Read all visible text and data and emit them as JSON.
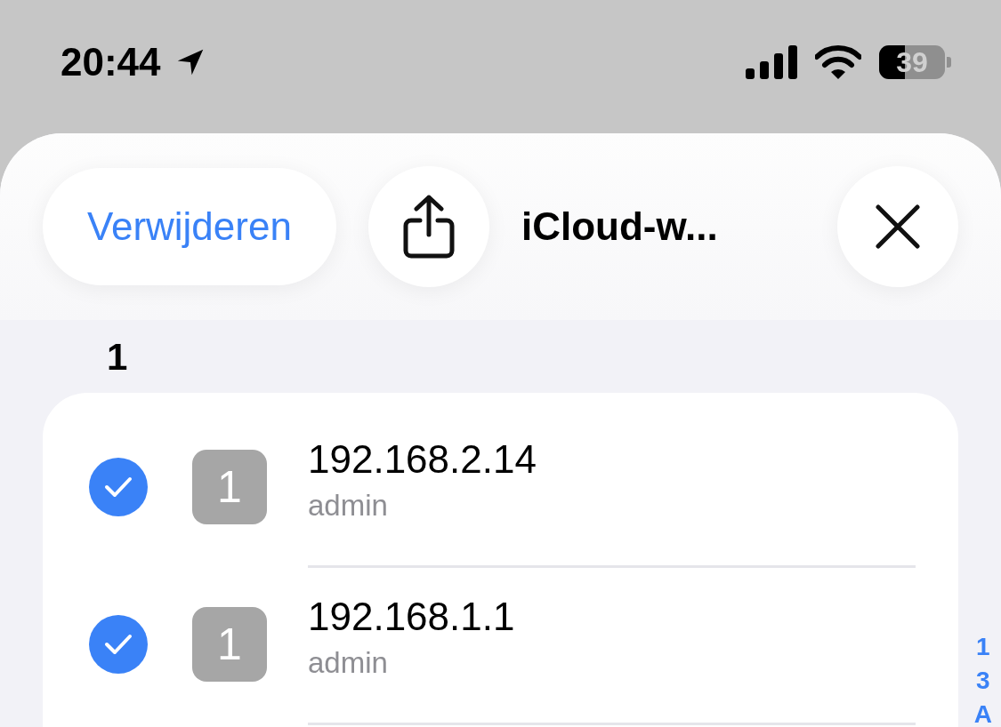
{
  "status_bar": {
    "time": "20:44",
    "battery": {
      "text": "39",
      "level": 0.39
    }
  },
  "header": {
    "delete_button": "Verwijderen",
    "title": "iCloud-w..."
  },
  "section": {
    "title": "1"
  },
  "rows": [
    {
      "address": "192.168.2.14",
      "user": "admin",
      "badge": "1",
      "checked": true
    },
    {
      "address": "192.168.1.1",
      "user": "admin",
      "badge": "1",
      "checked": true
    }
  ],
  "index": [
    "1",
    "3",
    "A"
  ]
}
